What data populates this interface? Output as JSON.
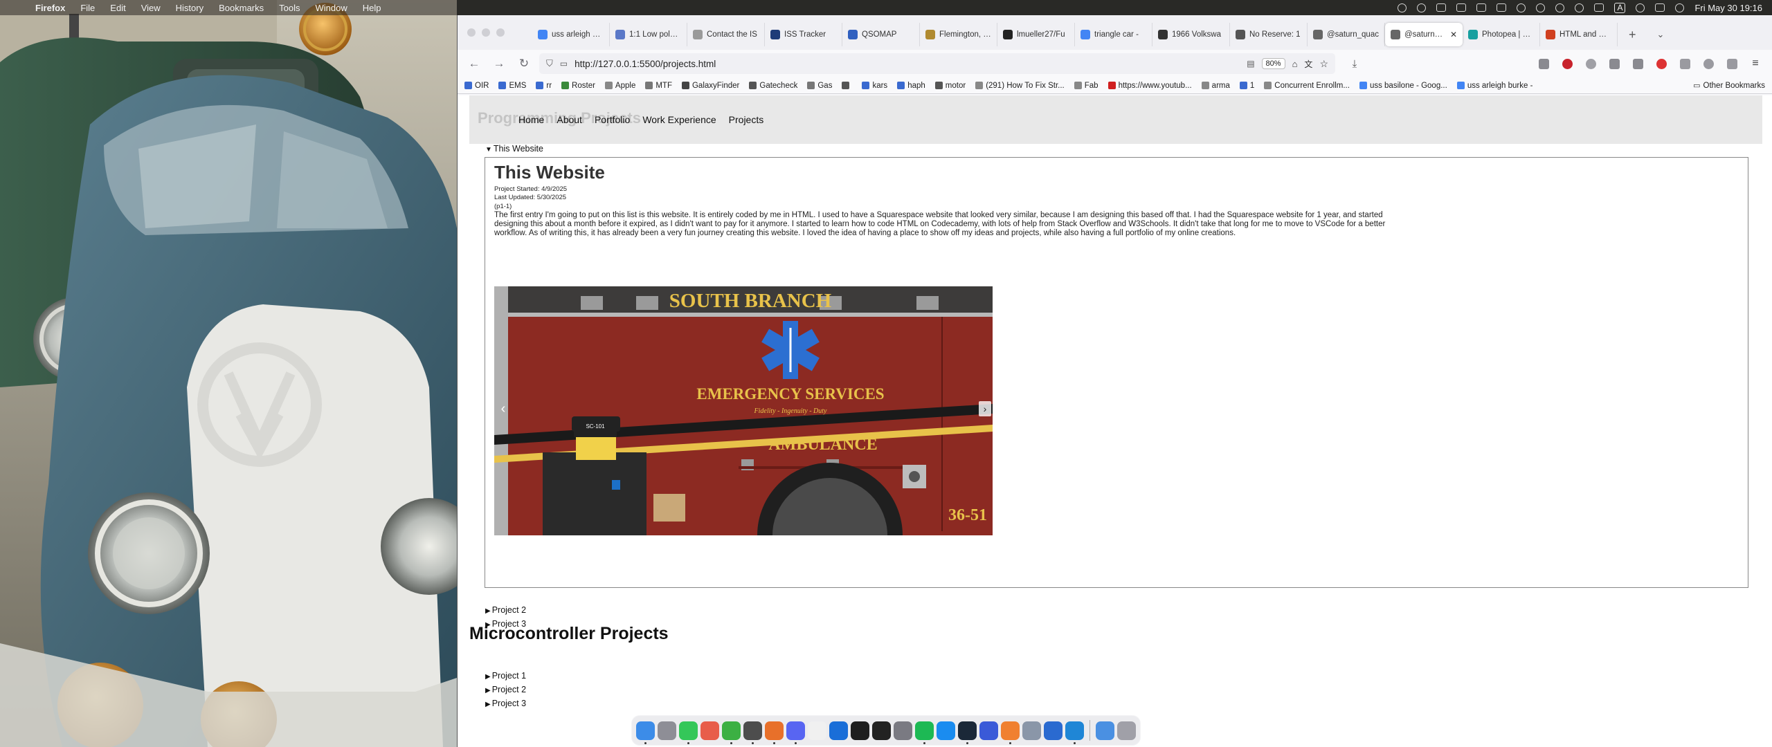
{
  "menubar": {
    "app": "Firefox",
    "items": [
      "File",
      "Edit",
      "View",
      "History",
      "Bookmarks",
      "Tools",
      "Window",
      "Help"
    ],
    "clock": "Fri May 30  19:16",
    "input_source": "A"
  },
  "browser": {
    "tabs": [
      {
        "label": "uss arleigh bur",
        "color": "#4285f4",
        "active": false
      },
      {
        "label": "1:1 Low poly U",
        "color": "#5a78c8",
        "active": false
      },
      {
        "label": "Contact the IS",
        "color": "#9a9a9a",
        "active": false
      },
      {
        "label": "ISS Tracker",
        "color": "#1e3c78",
        "active": false
      },
      {
        "label": "QSOMAP",
        "color": "#3060c0",
        "active": false
      },
      {
        "label": "Flemington, Ne",
        "color": "#b08a30",
        "active": false
      },
      {
        "label": "lmueller27/Fu",
        "color": "#222222",
        "active": false
      },
      {
        "label": "triangle car - ",
        "color": "#4285f4",
        "active": false
      },
      {
        "label": "1966 Volkswa",
        "color": "#333333",
        "active": false
      },
      {
        "label": "No Reserve: 1",
        "color": "#555555",
        "active": false
      },
      {
        "label": "@saturn_quac",
        "color": "#666666",
        "active": false
      },
      {
        "label": "@saturn_qu",
        "color": "#666666",
        "active": true
      },
      {
        "label": "Photopea | Onl",
        "color": "#18a0a0",
        "active": false
      },
      {
        "label": "HTML and CSS",
        "color": "#d04020",
        "active": false
      }
    ],
    "url": "http://127.0.0.1:5500/projects.html",
    "zoom": "80%",
    "bookmarks": [
      {
        "label": "OIR",
        "color": "#3a6ad0"
      },
      {
        "label": "EMS",
        "color": "#3a6ad0"
      },
      {
        "label": "rr",
        "color": "#3a6ad0"
      },
      {
        "label": "Roster",
        "color": "#3a8a3a"
      },
      {
        "label": "Apple",
        "color": "#888888"
      },
      {
        "label": "MTF",
        "color": "#777777"
      },
      {
        "label": "GalaxyFinder",
        "color": "#444444"
      },
      {
        "label": "Gatecheck",
        "color": "#555555"
      },
      {
        "label": "Gas",
        "color": "#777777"
      },
      {
        "label": "",
        "color": "#555555"
      },
      {
        "label": "kars",
        "color": "#3a6ad0"
      },
      {
        "label": "haph",
        "color": "#3a6ad0"
      },
      {
        "label": "motor",
        "color": "#555555"
      },
      {
        "label": "(291) How To Fix Str...",
        "color": "#888888"
      },
      {
        "label": "Fab",
        "color": "#888888"
      },
      {
        "label": "https://www.youtub...",
        "color": "#d02020"
      },
      {
        "label": "arma",
        "color": "#888888"
      },
      {
        "label": "1",
        "color": "#3a6ad0"
      },
      {
        "label": "Concurrent Enrollm...",
        "color": "#888888"
      },
      {
        "label": "uss basilone - Goog...",
        "color": "#4285f4"
      },
      {
        "label": "uss arleigh burke -",
        "color": "#4285f4"
      }
    ],
    "other_bookmarks": "Other Bookmarks"
  },
  "site": {
    "ghost_title": "Programming Projects",
    "nav": [
      "Home",
      "About",
      "Portfolio",
      "Work Experience",
      "Projects"
    ],
    "open_summary": "This Website",
    "project": {
      "title": "This Website",
      "started": "Project Started: 4/9/2025",
      "updated": "Last Updated: 5/30/2025",
      "id": "(p1-1)",
      "description": "The first entry I'm going to put on this list is this website. It is entirely coded by me in HTML. I used to have a Squarespace website that looked very similar, because I am designing this based off that. I had the Squarespace website for 1 year, and started designing this about a month before it expired, as I didn't want to pay for it anymore. I started to learn how to code HTML on Codecademy, with lots of help from Stack Overflow and W3Schools. It didn't take that long for me to move to VSCode for a better workflow. As of writing this, it has already been a very fun journey creating this website. I loved the idea of having a place to show off my ideas and projects, while also having a full portfolio of my online creations.",
      "slide": {
        "header": "SOUTH BRANCH",
        "line1": "EMERGENCY SERVICES",
        "motto": "Fidelity - Ingenuity - Duty",
        "line2": "AMBULANCE",
        "unit": "36-51",
        "badge": "SC-101"
      }
    },
    "programming_collapsed": [
      "Project 2",
      "Project 3"
    ],
    "micro_heading": "Microcontroller Projects",
    "micro_projects": [
      "Project 1",
      "Project 2",
      "Project 3"
    ]
  },
  "dock": {
    "apps": [
      {
        "name": "finder",
        "color": "#3c8ce8",
        "running": true
      },
      {
        "name": "launchpad",
        "color": "#8e8e96",
        "running": false
      },
      {
        "name": "messages",
        "color": "#34c759",
        "running": true
      },
      {
        "name": "photos",
        "color": "#e85d4a",
        "running": false
      },
      {
        "name": "facetime",
        "color": "#3cb043",
        "running": true
      },
      {
        "name": "chrome",
        "color": "#4d4d4d",
        "running": true
      },
      {
        "name": "firefox",
        "color": "#e8702a",
        "running": true
      },
      {
        "name": "discord",
        "color": "#5865f2",
        "running": true
      },
      {
        "name": "chatgpt",
        "color": "#f0f0f0",
        "running": false
      },
      {
        "name": "1password",
        "color": "#1a6ed8",
        "running": false
      },
      {
        "name": "terminal-alt",
        "color": "#1e1e1e",
        "running": false
      },
      {
        "name": "terminal",
        "color": "#222222",
        "running": false
      },
      {
        "name": "system-settings",
        "color": "#7a7a82",
        "running": false
      },
      {
        "name": "spotify",
        "color": "#1db954",
        "running": true
      },
      {
        "name": "app-store",
        "color": "#1a8cf0",
        "running": false
      },
      {
        "name": "steam",
        "color": "#1b2838",
        "running": true
      },
      {
        "name": "qsstv",
        "color": "#3a5ad8",
        "running": false
      },
      {
        "name": "blender",
        "color": "#f08030",
        "running": true
      },
      {
        "name": "preview",
        "color": "#8a96a8",
        "running": false
      },
      {
        "name": "vscode-insiders",
        "color": "#2a6ad0",
        "running": false
      },
      {
        "name": "vscode",
        "color": "#1f86d6",
        "running": true
      },
      {
        "name": "downloads",
        "color": "#4a90e2",
        "running": false
      },
      {
        "name": "trash",
        "color": "#a0a0a8",
        "running": false
      }
    ]
  }
}
